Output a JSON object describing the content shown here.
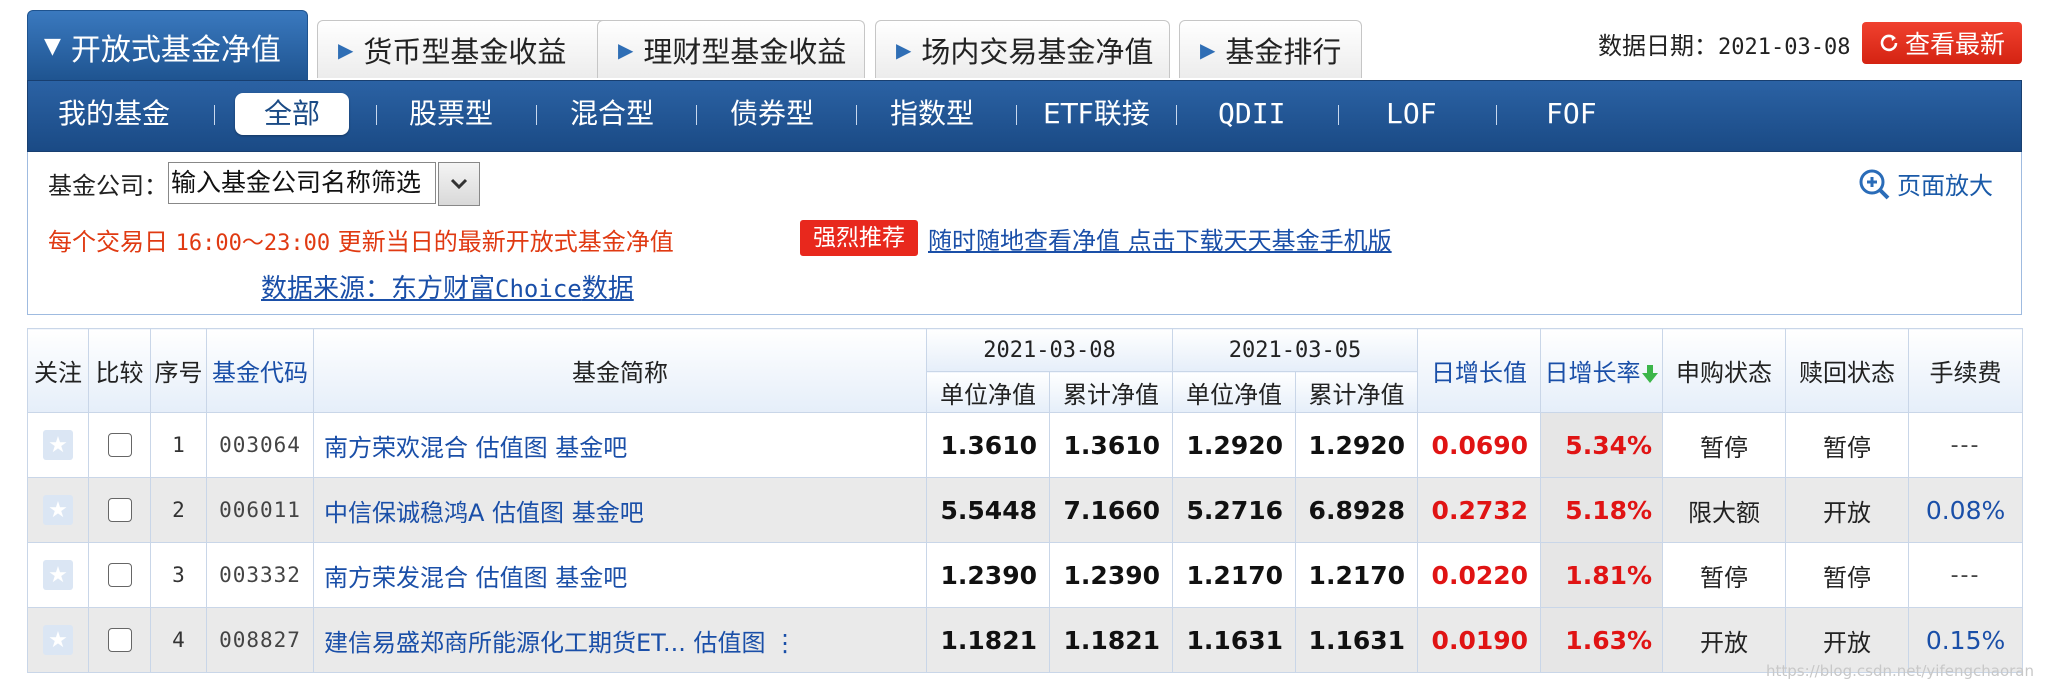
{
  "tabs": [
    {
      "label": "开放式基金净值",
      "active": true
    },
    {
      "label": "货币型基金收益",
      "active": false
    },
    {
      "label": "理财型基金收益",
      "active": false
    },
    {
      "label": "场内交易基金净值",
      "active": false
    },
    {
      "label": "基金排行",
      "active": false
    }
  ],
  "data_date": {
    "label": "数据日期：",
    "value": "2021-03-08"
  },
  "latest_button": "查看最新",
  "categories": {
    "my_funds": "我的基金",
    "all": "全部",
    "stock": "股票型",
    "mixed": "混合型",
    "bond": "债券型",
    "index": "指数型",
    "etf_link": "ETF联接",
    "qdii": "QDII",
    "lof": "LOF",
    "fof": "FOF"
  },
  "filter": {
    "company_label": "基金公司：",
    "company_placeholder": "输入基金公司名称筛选",
    "zoom_label": "页面放大",
    "notice_prefix": "每个交易日 ",
    "notice_time": "16:00～23:00",
    "notice_suffix": " 更新当日的最新开放式基金净值",
    "badge": "强烈推荐",
    "app_link": "随时随地查看净值 点击下载天天基金手机版",
    "source_prefix": "数据来源：东方财富",
    "source_mono": "Choice",
    "source_suffix": "数据"
  },
  "table": {
    "headers": {
      "follow": "关注",
      "compare": "比较",
      "seq": "序号",
      "code": "基金代码",
      "name": "基金简称",
      "date1": "2021-03-08",
      "date2": "2021-03-05",
      "unit_nav": "单位净值",
      "acc_nav": "累计净值",
      "daily_growth": "日增长值",
      "daily_rate": "日增长率",
      "purchase": "申购状态",
      "redeem": "赎回状态",
      "fee": "手续费"
    },
    "rows": [
      {
        "seq": "1",
        "code": "003064",
        "name": "南方荣欢混合",
        "links": "估值图 基金吧",
        "nav1": "1.3610",
        "acc1": "1.3610",
        "nav2": "1.2920",
        "acc2": "1.2920",
        "growth": "0.0690",
        "rate": "5.34%",
        "purchase": "暂停",
        "redeem": "暂停",
        "fee": "---"
      },
      {
        "seq": "2",
        "code": "006011",
        "name": "中信保诚稳鸿A",
        "links": "估值图 基金吧",
        "nav1": "5.5448",
        "acc1": "7.1660",
        "nav2": "5.2716",
        "acc2": "6.8928",
        "growth": "0.2732",
        "rate": "5.18%",
        "purchase": "限大额",
        "redeem": "开放",
        "fee": "0.08%"
      },
      {
        "seq": "3",
        "code": "003332",
        "name": "南方荣发混合",
        "links": "估值图 基金吧",
        "nav1": "1.2390",
        "acc1": "1.2390",
        "nav2": "1.2170",
        "acc2": "1.2170",
        "growth": "0.0220",
        "rate": "1.81%",
        "purchase": "暂停",
        "redeem": "暂停",
        "fee": "---"
      },
      {
        "seq": "4",
        "code": "008827",
        "name": "建信易盛郑商所能源化工期货ET...",
        "links": "估值图 ⋮",
        "nav1": "1.1821",
        "acc1": "1.1821",
        "nav2": "1.1631",
        "acc2": "1.1631",
        "growth": "0.0190",
        "rate": "1.63%",
        "purchase": "开放",
        "redeem": "开放",
        "fee": "0.15%"
      }
    ]
  },
  "watermark": "https://blog.csdn.net/yifengchaoran"
}
